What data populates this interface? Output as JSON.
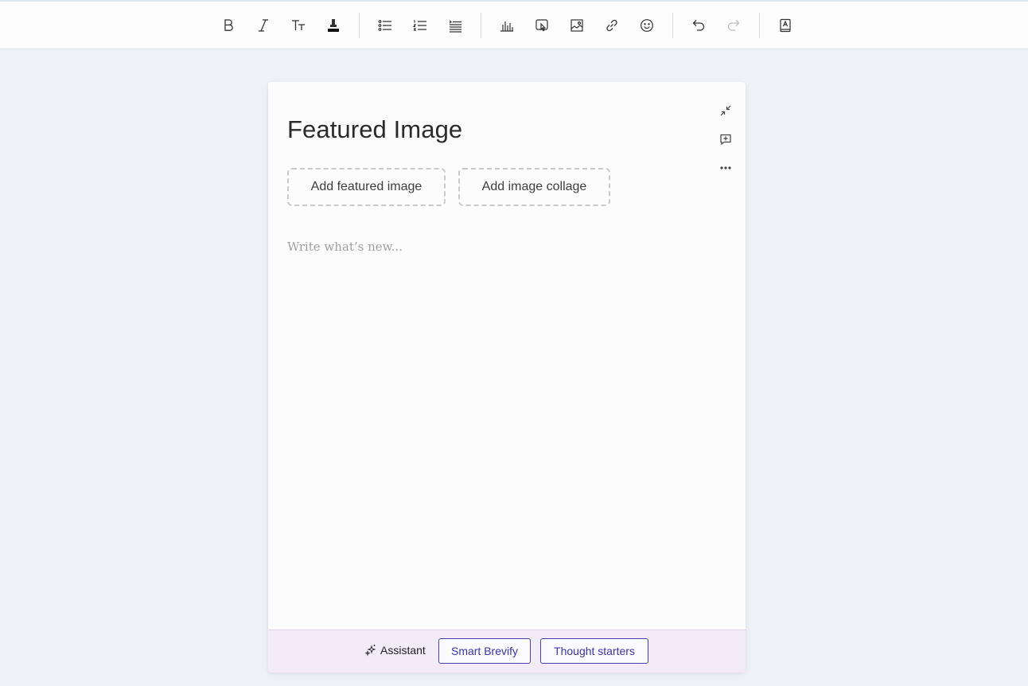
{
  "toolbar": {
    "tools": [
      {
        "name": "bold-icon"
      },
      {
        "name": "italic-icon"
      },
      {
        "name": "text-size-icon"
      },
      {
        "name": "highlight-icon"
      },
      {
        "name": "bullet-list-icon"
      },
      {
        "name": "numbered-list-icon"
      },
      {
        "name": "indent-icon"
      },
      {
        "name": "chart-icon"
      },
      {
        "name": "embed-icon"
      },
      {
        "name": "image-icon"
      },
      {
        "name": "link-icon"
      },
      {
        "name": "emoji-icon"
      },
      {
        "name": "undo-icon"
      },
      {
        "name": "redo-icon"
      },
      {
        "name": "dictionary-icon"
      }
    ]
  },
  "editor": {
    "title": "Featured Image",
    "add_featured_image": "Add featured image",
    "add_image_collage": "Add image collage",
    "body_placeholder": "Write what’s new..."
  },
  "side_actions": [
    "collapse-icon",
    "add-comment-icon",
    "more-options-icon"
  ],
  "assistant": {
    "label": "Assistant",
    "buttons": [
      "Smart Brevify",
      "Thought starters"
    ]
  },
  "colors": {
    "background": "#eef2f7",
    "assistant_bar": "#f3ebf8",
    "accent": "#3b34a6"
  }
}
